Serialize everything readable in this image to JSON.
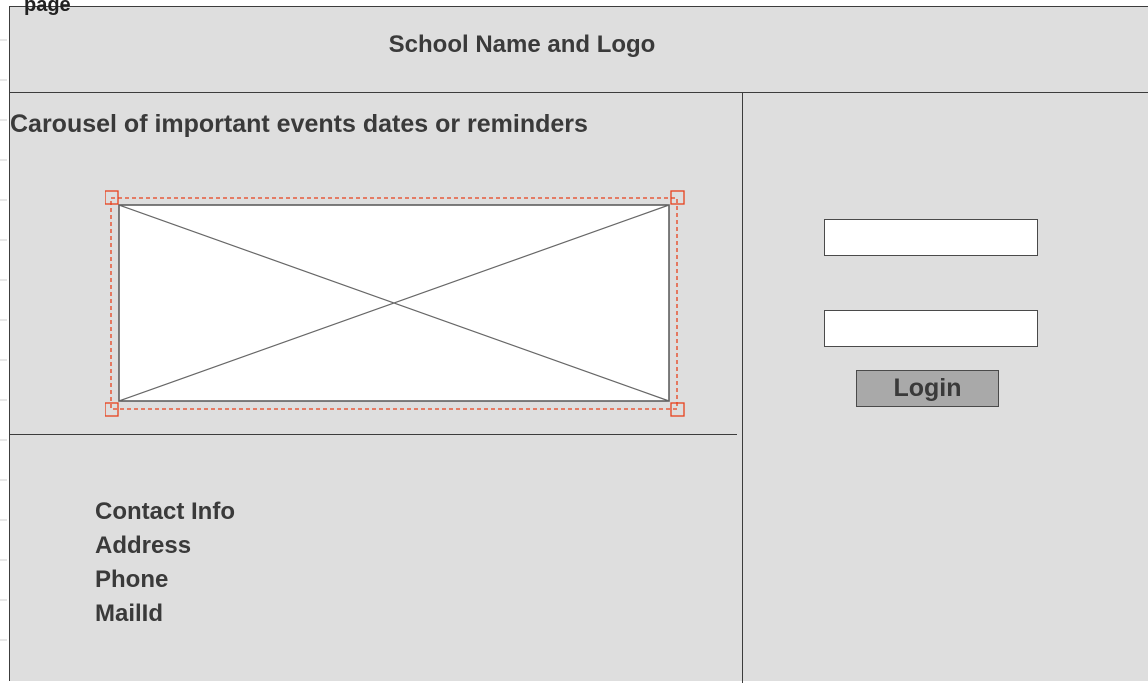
{
  "page_label": "page",
  "header": {
    "title": "School Name and Logo"
  },
  "carousel": {
    "title": "Carousel of important events dates or reminders"
  },
  "contact": {
    "lines": [
      "Contact Info",
      "Address",
      "Phone",
      "MailId"
    ]
  },
  "login": {
    "field_1_value": "",
    "field_2_value": "",
    "button_label": "Login"
  },
  "colors": {
    "panel_background": "#dedede",
    "border": "#3c3c3c",
    "selection_outline": "#e8401c",
    "button_background": "#a9a9a9",
    "text": "#3a3a3a"
  }
}
